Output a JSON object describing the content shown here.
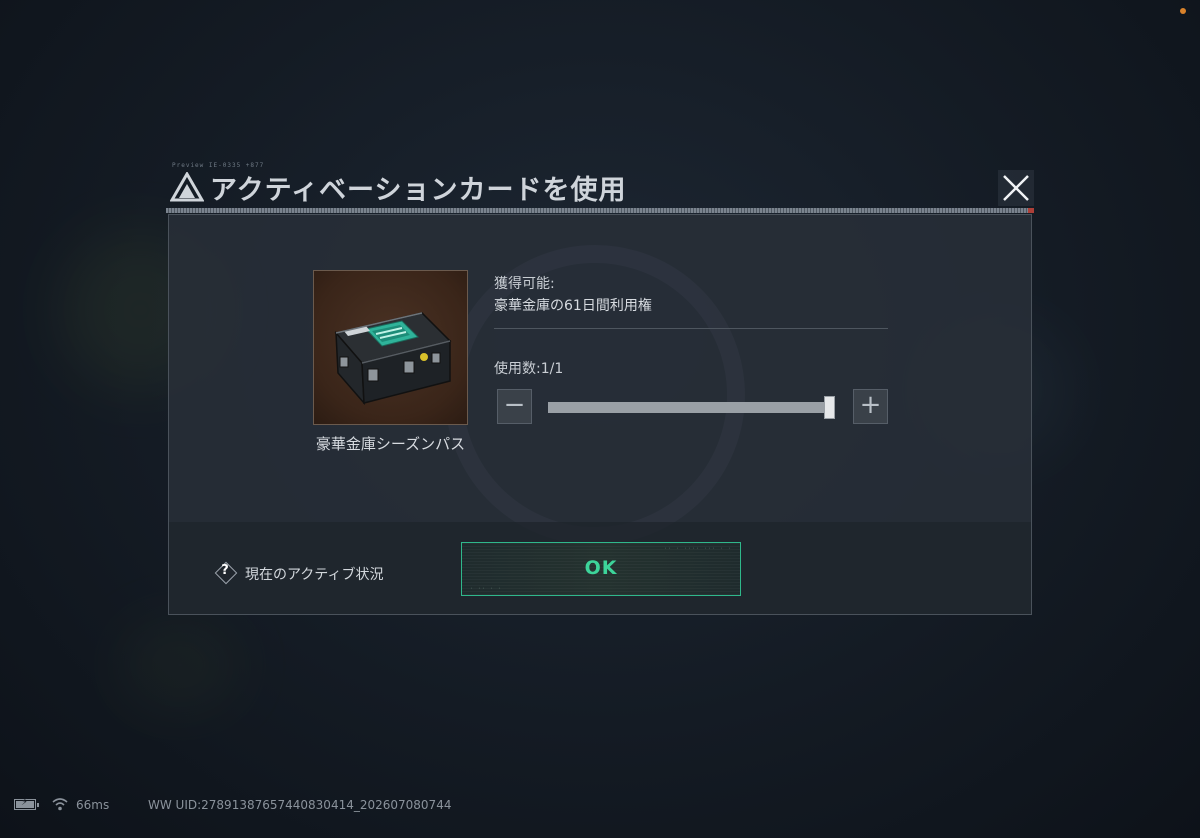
{
  "dialog": {
    "title": "アクティベーションカードを使用",
    "title_tag": "Preview IE-0335 +877",
    "item_name": "豪華金庫シーズンパス",
    "obtainable_label": "獲得可能:",
    "reward_text": "豪華金庫の61日間利用権",
    "usage_count_label": "使用数:1/1",
    "slider_value": 1,
    "slider_max": 1,
    "minus_label": "−",
    "plus_label": "+",
    "help_text": "現在のアクティブ状況",
    "help_icon_glyph": "?",
    "ok_label": "OK",
    "ok_tag_top": "·· · ···· ··· · ·",
    "ok_tag_bottom": "· ·· · ·"
  },
  "footer": {
    "ping": "66ms",
    "uid": "WW UID:27891387657440830414_202607080744"
  },
  "colors": {
    "accent": "#3dd49a",
    "panel": "#282f38",
    "status_dot": "#d9822b",
    "close_stripe": "#c8463c"
  },
  "icons": [
    "logo-icon",
    "close-icon",
    "vault-case-icon",
    "help-icon",
    "battery-icon",
    "wifi-icon"
  ]
}
